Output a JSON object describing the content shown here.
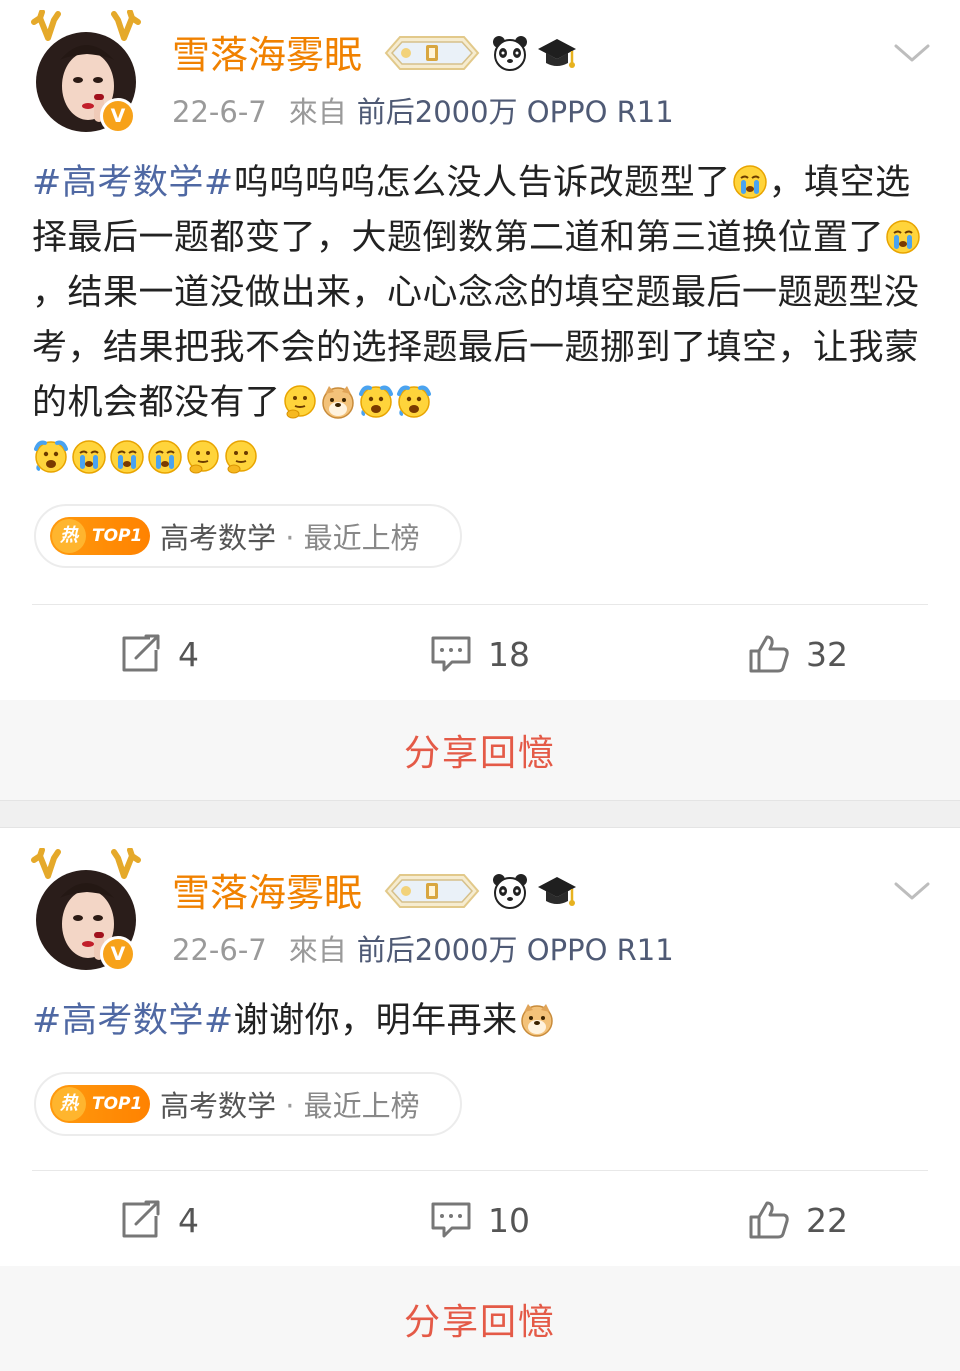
{
  "colors": {
    "username": "#f08100",
    "hashtag": "#4f68a3",
    "source": "#4f5a75",
    "meta": "#9a9a9a",
    "share": "#e45a47",
    "chip_badge": "#ff8a00",
    "separator": "#f0f0f0"
  },
  "posts": [
    {
      "username": "雪落海雾眠",
      "verified_mark": "V",
      "badges": [
        "level-badge-icon",
        "panda-icon",
        "graduation-cap-icon"
      ],
      "date": "22-6-7",
      "from_label": "來自",
      "source": "前后2000万 OPPO R11",
      "hashtag": "#高考数学#",
      "text_1": "呜呜呜呜怎么没人告诉改题型了",
      "text_2": "，填空选择最后一题都变了，大题倒数第二道和第三道换位置了",
      "text_3": "，结果一道没做出来，心心念念的填空题最后一题题型没考，结果把我不会的选择题最后一题挪到了填空，让我蒙的机会都没有了",
      "topic": {
        "hot_label": "热",
        "rank_label": "TOP1",
        "name": "高考数学",
        "separator": " · ",
        "status": "最近上榜"
      },
      "actions": {
        "repost_count": "4",
        "comment_count": "18",
        "like_count": "32"
      },
      "share_label": "分享回憶"
    },
    {
      "username": "雪落海雾眠",
      "verified_mark": "V",
      "badges": [
        "level-badge-icon",
        "panda-icon",
        "graduation-cap-icon"
      ],
      "date": "22-6-7",
      "from_label": "來自",
      "source": "前后2000万 OPPO R11",
      "hashtag": "#高考数学#",
      "text_1": "谢谢你，明年再来",
      "topic": {
        "hot_label": "热",
        "rank_label": "TOP1",
        "name": "高考数学",
        "separator": " · ",
        "status": "最近上榜"
      },
      "actions": {
        "repost_count": "4",
        "comment_count": "10",
        "like_count": "22"
      },
      "share_label": "分享回憶"
    }
  ]
}
